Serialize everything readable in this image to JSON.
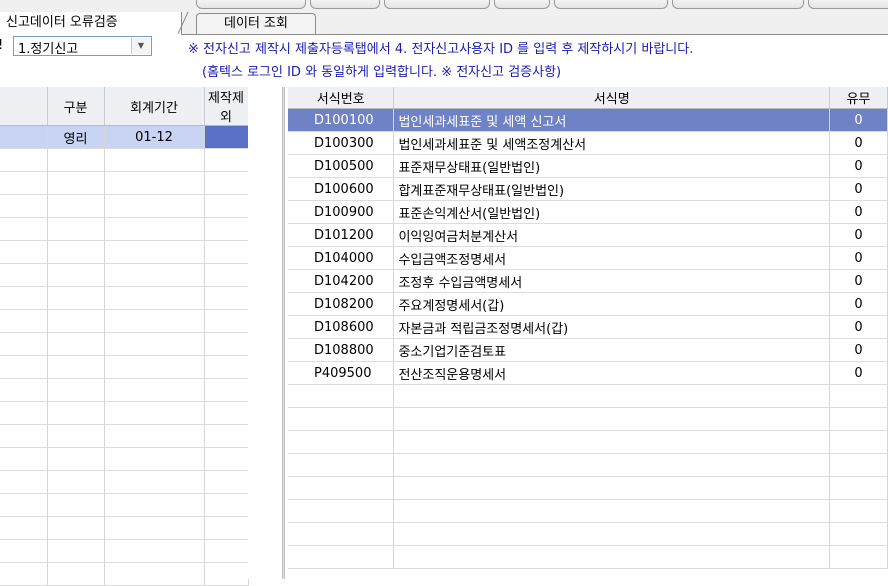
{
  "tabs": [
    {
      "label": "신고데이터 오류검증",
      "active": true
    },
    {
      "label": "데이터 조회",
      "active": false
    }
  ],
  "filter": {
    "label_fragment": "!",
    "filing_type_value": "1.정기신고"
  },
  "notice": {
    "line1": "※ 전자신고 제작시 제출자등록탭에서 4. 전자신고사용자 ID 를 입력 후 제작하시기 바랍니다.",
    "line2": "(홈텍스 로그인 ID 와 동일하게 입력합니다. ※ 전자신고 검증사항)"
  },
  "left_table": {
    "headers": [
      "구분",
      "회계기간",
      "제작제외"
    ],
    "rows": [
      {
        "type": "영리",
        "period": "01-12",
        "exclude": ""
      }
    ]
  },
  "right_table": {
    "headers": [
      "서식번호",
      "서식명",
      "유무"
    ],
    "rows": [
      {
        "code": "D100100",
        "name": "법인세과세표준 및 세액 신고서",
        "flag": "0"
      },
      {
        "code": "D100300",
        "name": "법인세과세표준 및 세액조정계산서",
        "flag": "0"
      },
      {
        "code": "D100500",
        "name": "표준재무상태표(일반법인)",
        "flag": "0"
      },
      {
        "code": "D100600",
        "name": "합계표준재무상태표(일반법인)",
        "flag": "0"
      },
      {
        "code": "D100900",
        "name": "표준손익계산서(일반법인)",
        "flag": "0"
      },
      {
        "code": "D101200",
        "name": "이익잉여금처분계산서",
        "flag": "0"
      },
      {
        "code": "D104000",
        "name": "수입금액조정명세서",
        "flag": "0"
      },
      {
        "code": "D104200",
        "name": "조정후 수입금액명세서",
        "flag": "0"
      },
      {
        "code": "D108200",
        "name": "주요계정명세서(갑)",
        "flag": "0"
      },
      {
        "code": "D108600",
        "name": "자본금과 적립금조정명세서(갑)",
        "flag": "0"
      },
      {
        "code": "D108800",
        "name": "중소기업기준검토표",
        "flag": "0"
      },
      {
        "code": "P409500",
        "name": "전산조직운용명세서",
        "flag": "0"
      }
    ]
  },
  "colors": {
    "selected_row": "#6f82c6",
    "header_bg": "#eef0f4",
    "notice_text": "#1b1bb4"
  }
}
